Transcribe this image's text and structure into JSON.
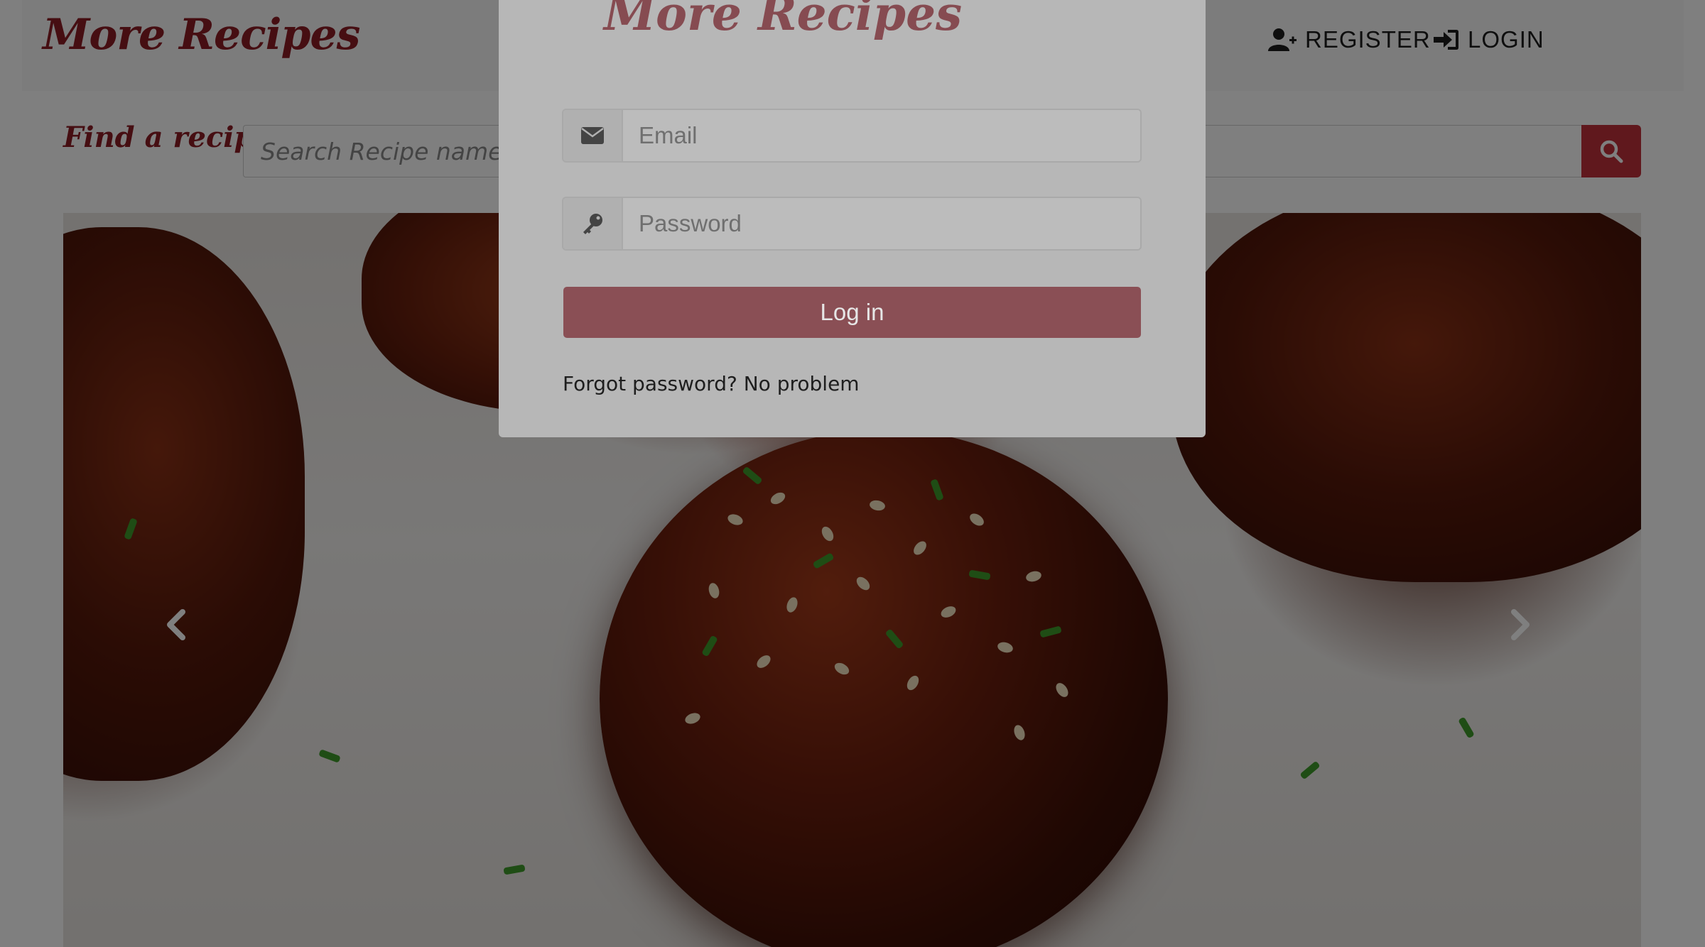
{
  "header": {
    "brand": "More Recipes",
    "nav": {
      "register_label": "REGISTER",
      "login_label": "LOGIN"
    }
  },
  "search": {
    "label": "Find a recipe:",
    "placeholder": "Search Recipe name or ingredient"
  },
  "carousel": {
    "prev_icon": "chevron-left-icon",
    "next_icon": "chevron-right-icon"
  },
  "login_modal": {
    "title": "More Recipes",
    "email_placeholder": "Email",
    "password_placeholder": "Password",
    "submit_label": "Log in",
    "forgot_text": "Forgot password? No problem"
  },
  "colors": {
    "brand": "#8c1c24",
    "accent_button": "#c0303a"
  }
}
